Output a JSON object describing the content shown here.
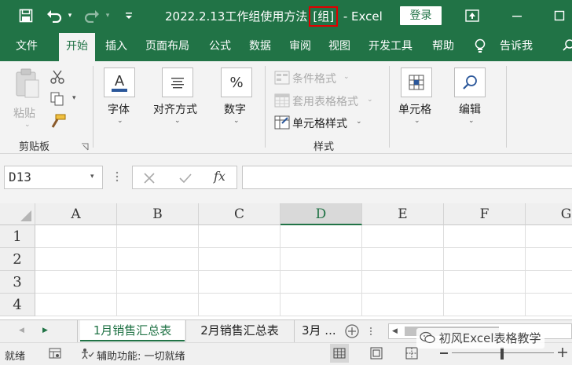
{
  "titlebar": {
    "filename": "2022.2.13工作组使用方法",
    "group_tag": "[组]",
    "app_sep": " - ",
    "app_name": "Excel",
    "login_label": "登录"
  },
  "tabs": [
    {
      "label": "文件",
      "active": false
    },
    {
      "label": "开始",
      "active": true
    },
    {
      "label": "插入",
      "active": false
    },
    {
      "label": "页面布局",
      "active": false
    },
    {
      "label": "公式",
      "active": false
    },
    {
      "label": "数据",
      "active": false
    },
    {
      "label": "审阅",
      "active": false
    },
    {
      "label": "视图",
      "active": false
    },
    {
      "label": "开发工具",
      "active": false
    },
    {
      "label": "帮助",
      "active": false
    },
    {
      "label": "告诉我",
      "active": false
    }
  ],
  "ribbon": {
    "clipboard": {
      "paste_label": "粘贴",
      "group_label": "剪贴板"
    },
    "font_label": "字体",
    "align_label": "对齐方式",
    "number_label": "数字",
    "styles": {
      "conditional_label": "条件格式",
      "table_format_label": "套用表格格式",
      "cell_style_label": "单元格样式",
      "group_label": "样式"
    },
    "cells_label": "单元格",
    "editing_label": "编辑"
  },
  "formula_bar": {
    "name_box": "D13",
    "fx_label": "fx",
    "formula": ""
  },
  "grid": {
    "columns": [
      "A",
      "B",
      "C",
      "D",
      "E",
      "F",
      "G"
    ],
    "selected_column": "D",
    "rows": [
      "1",
      "2",
      "3",
      "4"
    ]
  },
  "sheets": {
    "tabs": [
      "1月销售汇总表",
      "2月销售汇总表",
      "3月 ..."
    ],
    "active_index": 0
  },
  "statusbar": {
    "ready": "就绪",
    "accessibility": "辅助功能: 一切就绪"
  },
  "watermark": "初风Excel表格教学",
  "colors": {
    "accent": "#217346",
    "highlight_border": "#e00000"
  }
}
